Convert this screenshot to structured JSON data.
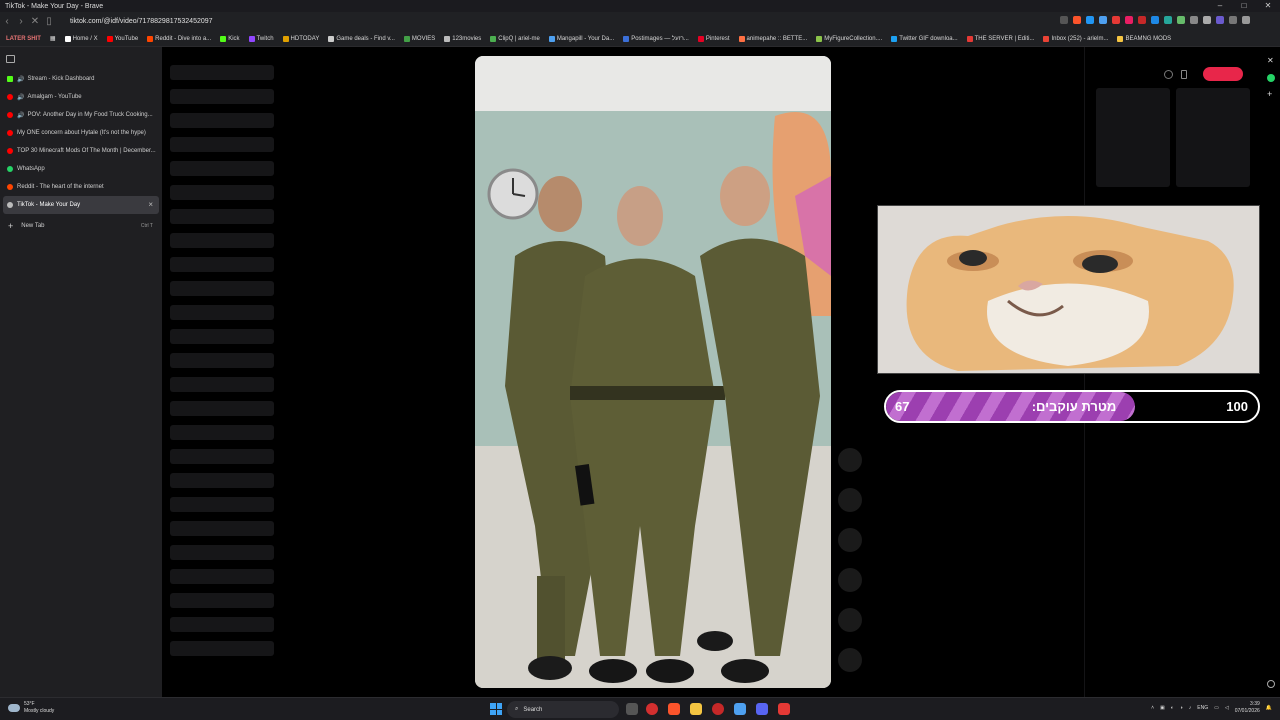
{
  "window": {
    "title": "TikTok - Make Your Day - Brave",
    "controls": [
      "–",
      "□",
      "✕"
    ]
  },
  "address_bar": {
    "url": "tiktok.com/@idf/video/7178829817532452097"
  },
  "bookmarks": {
    "first": "LATER SHIT",
    "items": [
      {
        "label": "Home / X",
        "color": "#ffffff"
      },
      {
        "label": "YouTube",
        "color": "#ff0000"
      },
      {
        "label": "Reddit - Dive into a...",
        "color": "#ff4500"
      },
      {
        "label": "Kick",
        "color": "#53fc18"
      },
      {
        "label": "Twitch",
        "color": "#9146ff"
      },
      {
        "label": "HDTODAY",
        "color": "#e0a000"
      },
      {
        "label": "Game deals - Find v...",
        "color": "#cccccc"
      },
      {
        "label": "MOVIES",
        "color": "#43a047"
      },
      {
        "label": "123movies",
        "color": "#bbbbbb"
      },
      {
        "label": "ClipQ | ariel-me",
        "color": "#4caf50"
      },
      {
        "label": "Mangapill - Your Da...",
        "color": "#4ea0f0"
      },
      {
        "label": "Postimages — רזעל...",
        "color": "#3b6fd8"
      },
      {
        "label": "Pinterest",
        "color": "#e60023"
      },
      {
        "label": "animepahe :: BETTE...",
        "color": "#ff7043"
      },
      {
        "label": "MyFigureCollection....",
        "color": "#8bc34a"
      },
      {
        "label": "Twitter GIF downloa...",
        "color": "#1da1f2"
      },
      {
        "label": "THE SERVER | Editi...",
        "color": "#e53935"
      },
      {
        "label": "Inbox (252) - arielm...",
        "color": "#ea4335"
      },
      {
        "label": "BEAMNG MODS",
        "color": "#f5c542"
      }
    ]
  },
  "sidebar": {
    "tabs": [
      {
        "label": "Stream - Kick Dashboard",
        "color": "#53fc18",
        "sound": true,
        "active": false
      },
      {
        "label": "Amalgam - YouTube",
        "color": "#ff0000",
        "sound": true,
        "active": false
      },
      {
        "label": "POV: Another Day in My Food Truck Cooking...",
        "color": "#ff0000",
        "sound": true,
        "active": false
      },
      {
        "label": "My ONE concern about Hytale (It's not the hype)",
        "color": "#ff0000",
        "sound": false,
        "active": false
      },
      {
        "label": "TOP 30 Minecraft Mods Of The Month | December...",
        "color": "#ff0000",
        "sound": false,
        "active": false
      },
      {
        "label": "WhatsApp",
        "color": "#25d366",
        "sound": false,
        "active": false
      },
      {
        "label": "Reddit - The heart of the internet",
        "color": "#ff4500",
        "sound": false,
        "active": false
      },
      {
        "label": "TikTok - Make Your Day",
        "color": "#bbbbbb",
        "sound": false,
        "active": true
      }
    ],
    "new_tab": {
      "label": "New Tab",
      "shortcut": "Ctrl T"
    }
  },
  "goal_widget": {
    "current": "67",
    "label": "מטרת עוקבים:",
    "max": "100",
    "progress_fraction": 0.67
  },
  "taskbar": {
    "weather_temp": "53°F",
    "weather_desc": "Mostly cloudy",
    "search_label": "Search",
    "lang": "ENG",
    "time": "3:39",
    "date": "07/01/2026"
  }
}
